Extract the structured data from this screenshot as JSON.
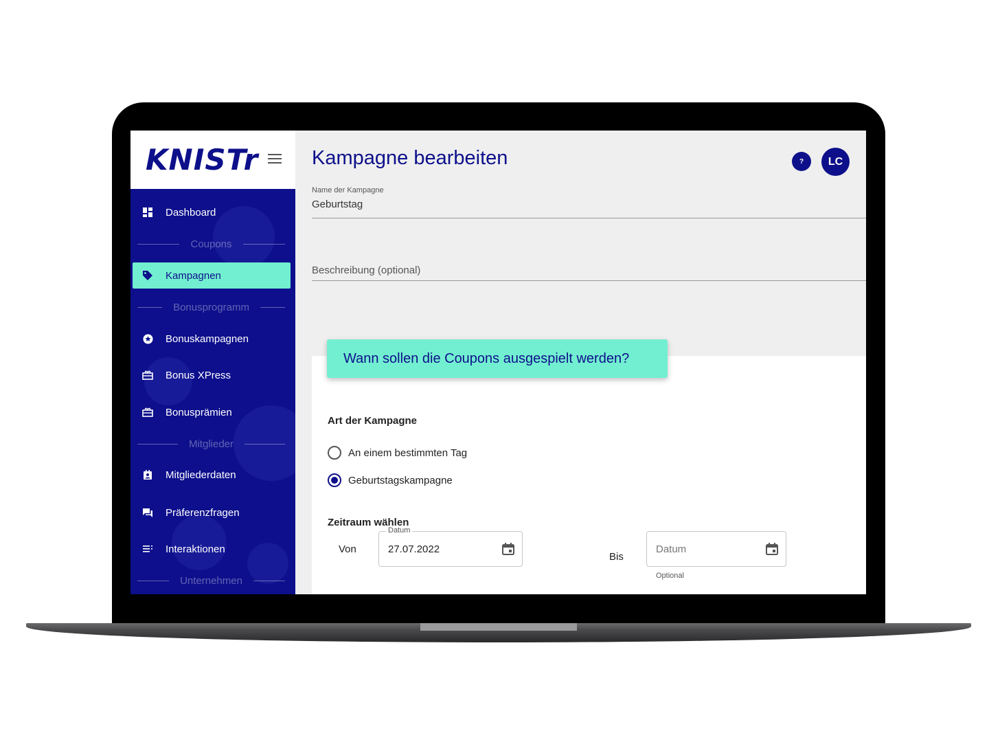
{
  "brand": {
    "logo": "KNISTr"
  },
  "sidebar": {
    "items": [
      {
        "type": "item",
        "label": "Dashboard",
        "icon": "dashboard-icon"
      },
      {
        "type": "section",
        "label": "Coupons"
      },
      {
        "type": "item",
        "label": "Kampagnen",
        "icon": "tag-icon",
        "active": true
      },
      {
        "type": "section",
        "label": "Bonusprogramm"
      },
      {
        "type": "item",
        "label": "Bonuskampagnen",
        "icon": "star-circle-icon"
      },
      {
        "type": "item",
        "label": "Bonus XPress",
        "icon": "gift-card-icon"
      },
      {
        "type": "item",
        "label": "Bonusprämien",
        "icon": "gift-card-icon"
      },
      {
        "type": "section",
        "label": "Mitglieder"
      },
      {
        "type": "item",
        "label": "Mitgliederdaten",
        "icon": "member-badge-icon"
      },
      {
        "type": "item",
        "label": "Präferenzfragen",
        "icon": "chat-bubbles-icon"
      },
      {
        "type": "item",
        "label": "Interaktionen",
        "icon": "list-icon"
      },
      {
        "type": "section",
        "label": "Unternehmen"
      }
    ]
  },
  "header": {
    "title": "Kampagne bearbeiten",
    "help_label": "?",
    "avatar_initials": "LC"
  },
  "form": {
    "name_label": "Name der Kampagne",
    "name_value": "Geburtstag",
    "description_placeholder": "Beschreibung (optional)"
  },
  "callout": {
    "text": "Wann sollen die Coupons ausgespielt werden?"
  },
  "campaign_type": {
    "title": "Art der Kampagne",
    "options": [
      {
        "label": "An einem bestimmten Tag",
        "selected": false
      },
      {
        "label": "Geburtstagskampagne",
        "selected": true
      }
    ]
  },
  "period": {
    "title": "Zeitraum wählen",
    "from_label": "Von",
    "from_field_label": "Datum",
    "from_value": "27.07.2022",
    "to_label": "Bis",
    "to_placeholder": "Datum",
    "to_hint": "Optional"
  },
  "colors": {
    "primary": "#0d108a",
    "accent": "#72efd1",
    "sidebar": "#0d0f8c"
  }
}
